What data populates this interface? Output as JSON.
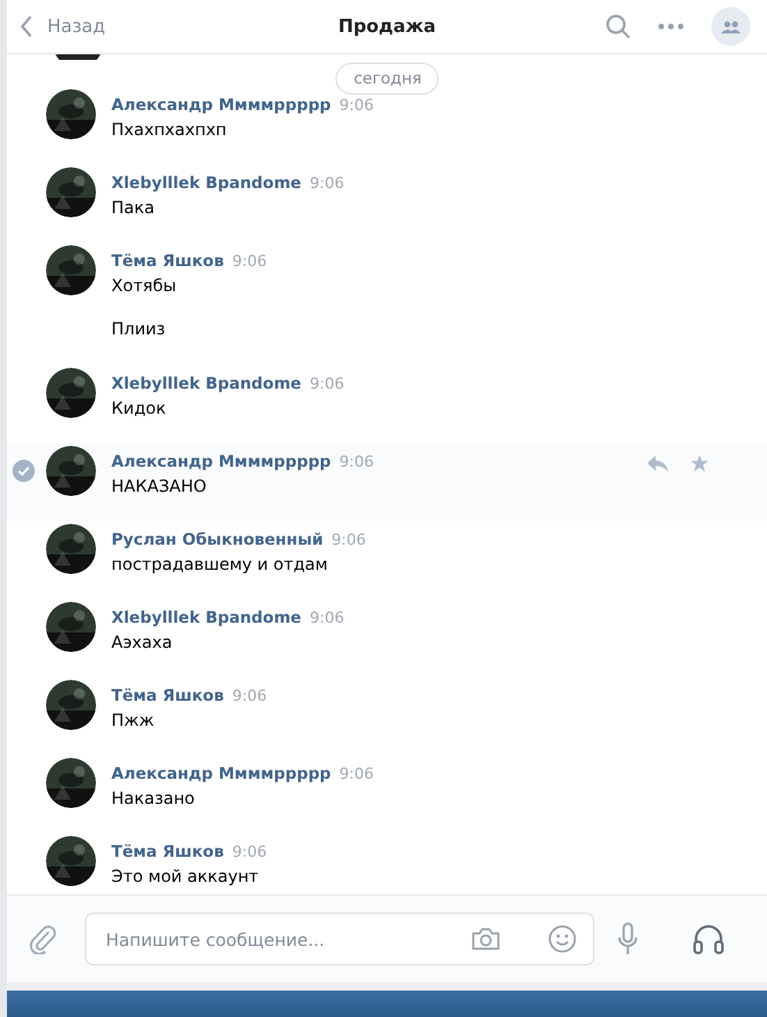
{
  "header": {
    "back": "Назад",
    "title": "Продажа"
  },
  "date_pill": "сегодня",
  "messages": [
    {
      "author": "Александр Ммммррррр",
      "time": "9:06",
      "texts": [
        "Пхахпхахпхп"
      ],
      "selected": false
    },
    {
      "author": "Xlebylllek Bpandome",
      "time": "9:06",
      "texts": [
        "Пака"
      ],
      "selected": false
    },
    {
      "author": "Тёма Яшков",
      "time": "9:06",
      "texts": [
        "Хотябы",
        "Плииз"
      ],
      "selected": false
    },
    {
      "author": "Xlebylllek Bpandome",
      "time": "9:06",
      "texts": [
        "Кидок"
      ],
      "selected": false
    },
    {
      "author": "Александр Ммммррррр",
      "time": "9:06",
      "texts": [
        "НАКАЗАНО"
      ],
      "selected": true
    },
    {
      "author": "Руслан Обыкновенный",
      "time": "9:06",
      "texts": [
        "пострадавшему и отдам"
      ],
      "selected": false
    },
    {
      "author": "Xlebylllek Bpandome",
      "time": "9:06",
      "texts": [
        "Аэхаха"
      ],
      "selected": false
    },
    {
      "author": "Тёма Яшков",
      "time": "9:06",
      "texts": [
        "Пжж"
      ],
      "selected": false
    },
    {
      "author": "Александр Ммммррррр",
      "time": "9:06",
      "texts": [
        "Наказано"
      ],
      "selected": false
    },
    {
      "author": "Тёма Яшков",
      "time": "9:06",
      "texts": [
        "Это мой аккаунт"
      ],
      "selected": false
    }
  ],
  "composer": {
    "placeholder": "Напишите сообщение..."
  }
}
